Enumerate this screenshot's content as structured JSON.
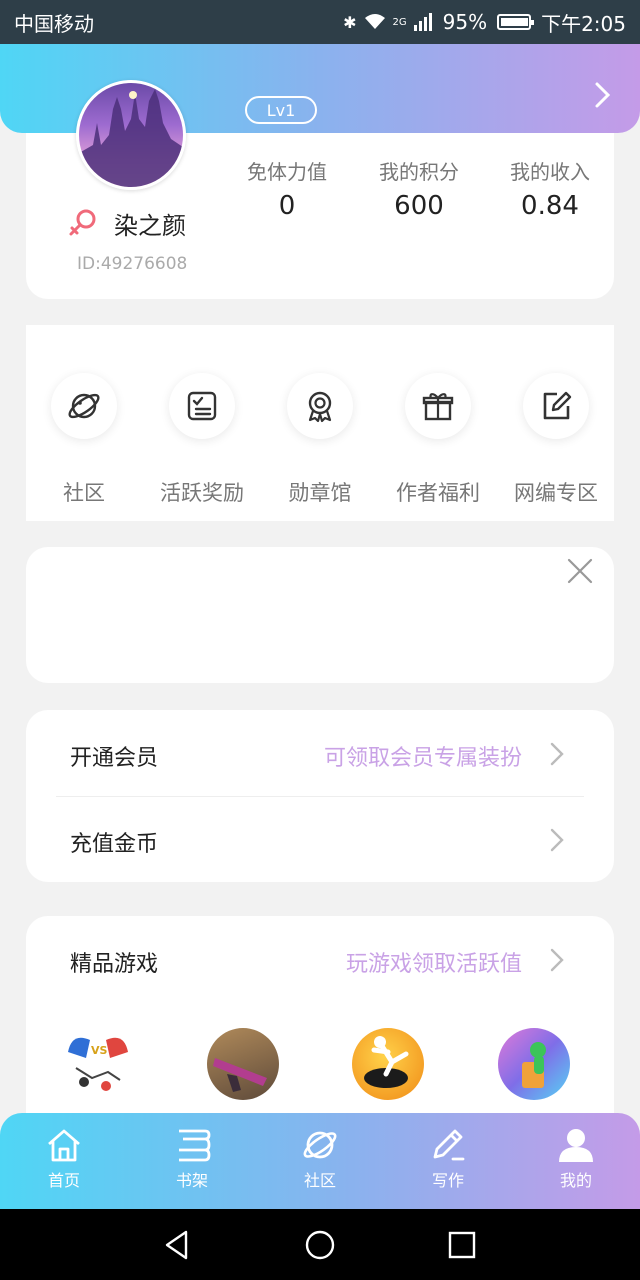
{
  "status_bar": {
    "carrier": "中国移动",
    "network": "2G",
    "battery": "95%",
    "time": "下午2:05"
  },
  "profile": {
    "level": "Lv1",
    "username": "染之颜",
    "user_id": "ID:49276608",
    "stats": [
      {
        "label": "免体力值",
        "value": "0"
      },
      {
        "label": "我的积分",
        "value": "600"
      },
      {
        "label": "我的收入",
        "value": "0.84"
      }
    ]
  },
  "menu": {
    "items": [
      {
        "label": "社区",
        "icon": "planet-icon"
      },
      {
        "label": "活跃奖励",
        "icon": "checklist-icon"
      },
      {
        "label": "勋章馆",
        "icon": "medal-icon"
      },
      {
        "label": "作者福利",
        "icon": "gift-icon"
      },
      {
        "label": "网编专区",
        "icon": "edit-icon"
      }
    ]
  },
  "vip": {
    "membership_label": "开通会员",
    "membership_hint": "可领取会员专属装扮",
    "recharge_label": "充值金币"
  },
  "games": {
    "title": "精品游戏",
    "hint": "玩游戏领取活跃值"
  },
  "tabbar": {
    "tabs": [
      {
        "label": "首页",
        "icon": "home-icon"
      },
      {
        "label": "书架",
        "icon": "bookshelf-icon"
      },
      {
        "label": "社区",
        "icon": "planet-icon"
      },
      {
        "label": "写作",
        "icon": "pen-icon"
      },
      {
        "label": "我的",
        "icon": "user-icon"
      }
    ],
    "active": "我的"
  },
  "colors": {
    "gradient_start": "#4fd6f5",
    "gradient_end": "#c49be8",
    "accent_text": "#c9a2e6",
    "gender": "#f06a7a"
  }
}
